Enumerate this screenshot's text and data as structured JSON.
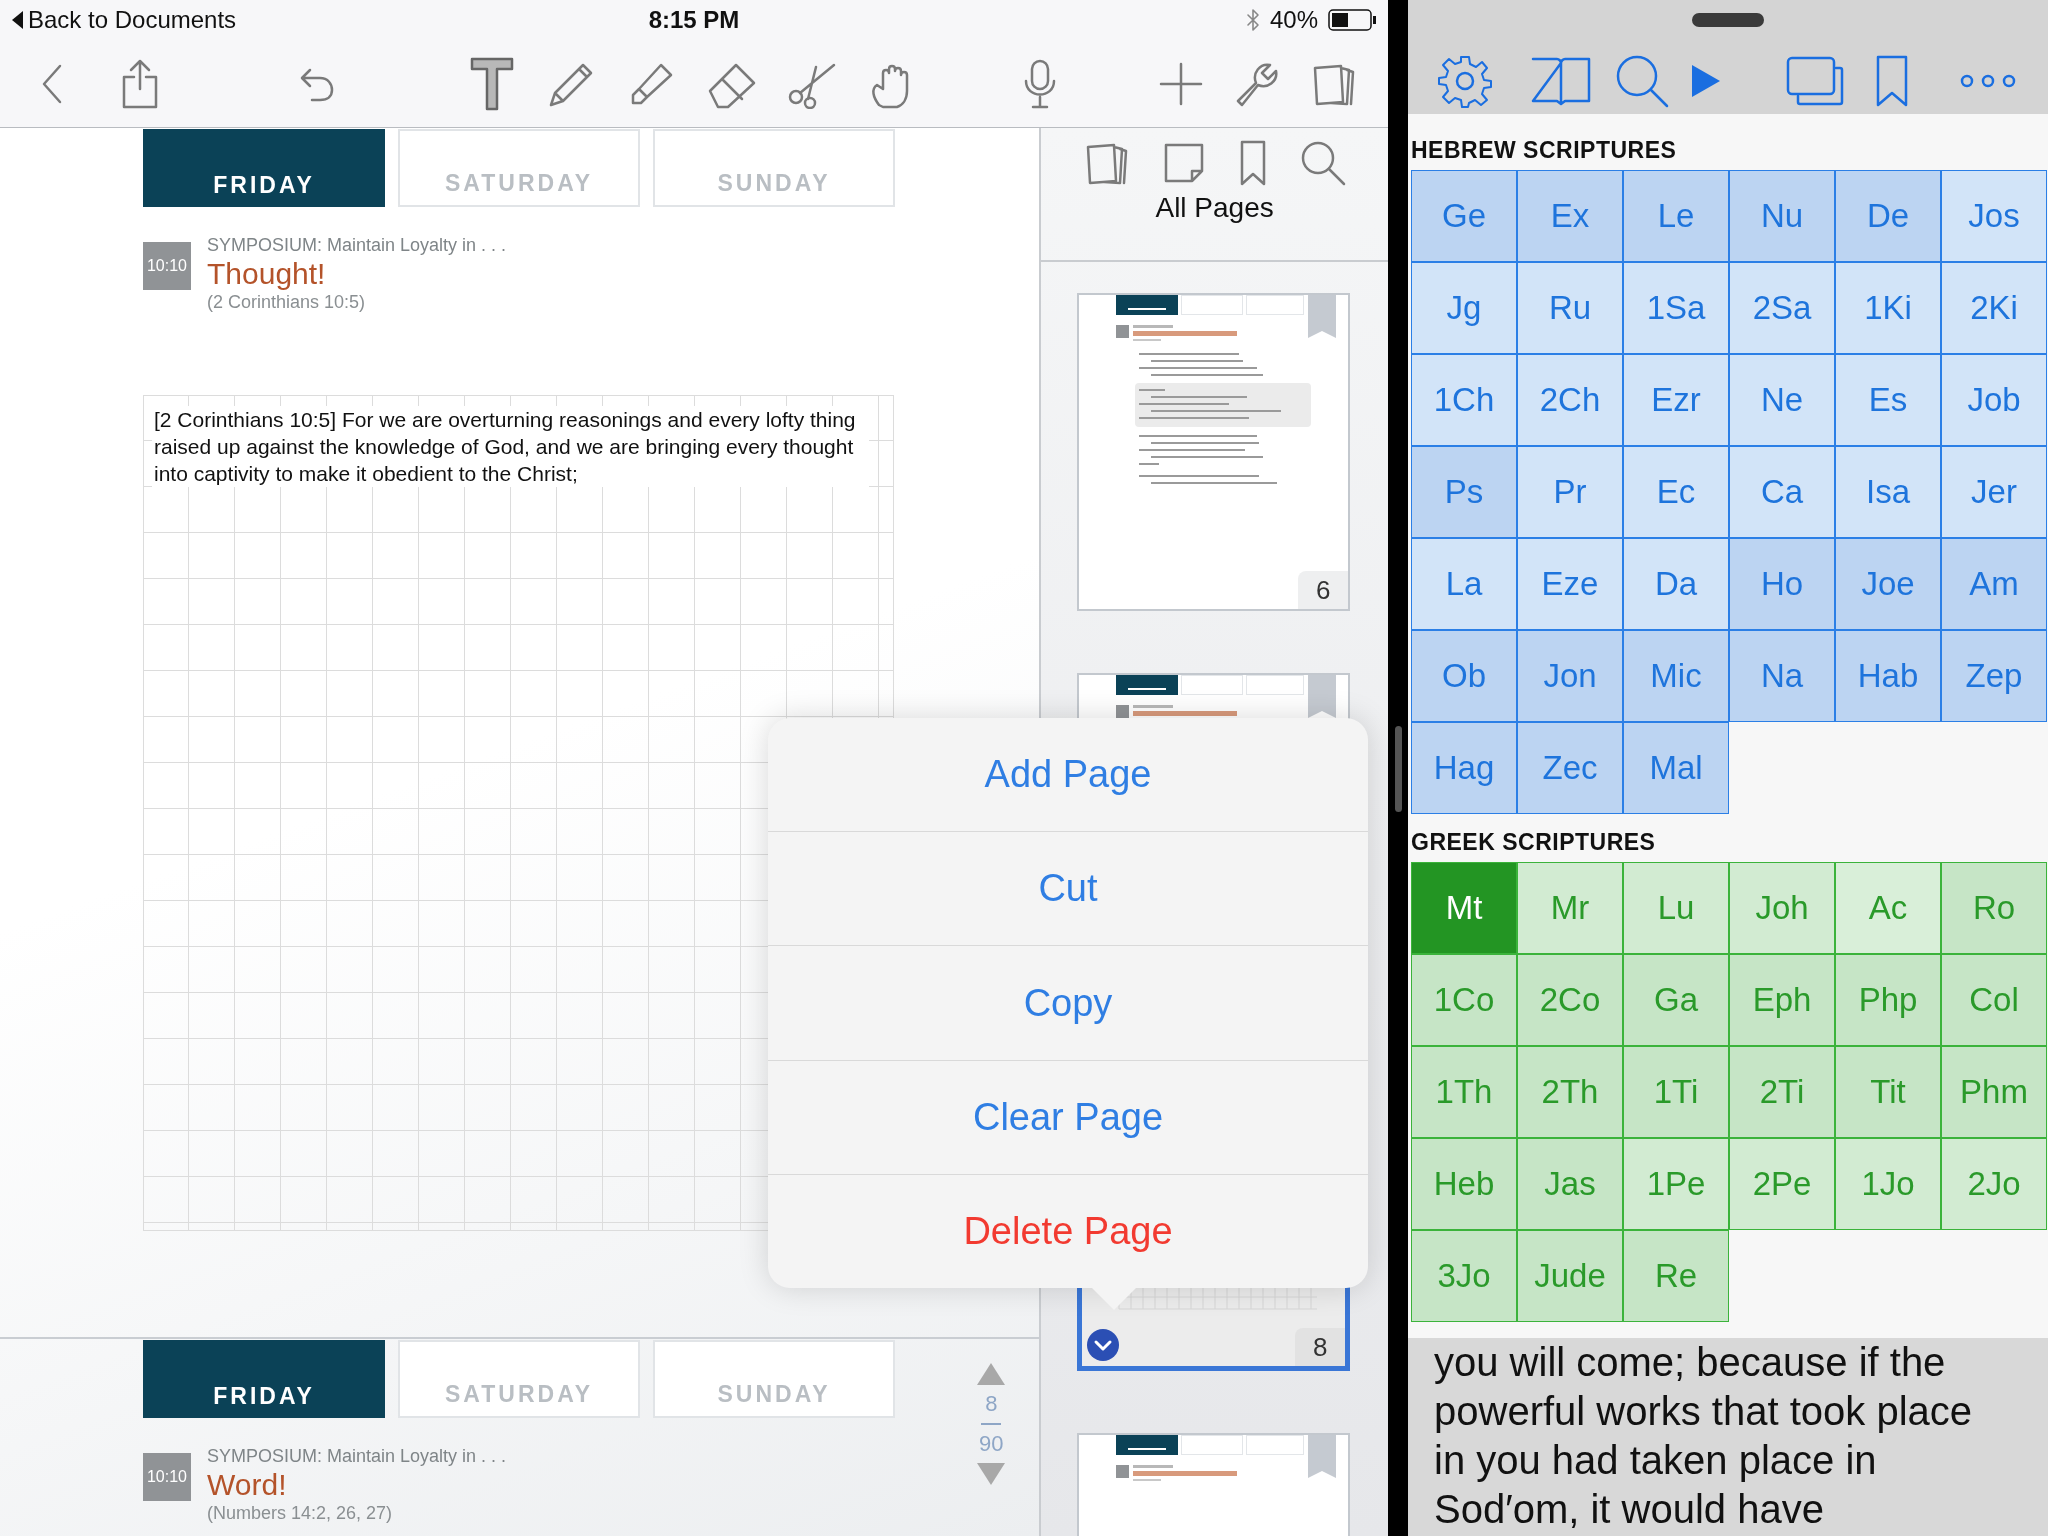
{
  "status_bar": {
    "back": "Back to Documents",
    "time": "8:15 PM",
    "battery": "40%"
  },
  "pages": [
    {
      "tabs": [
        {
          "label": "FRIDAY",
          "selected": true
        },
        {
          "label": "SATURDAY",
          "selected": false
        },
        {
          "label": "SUNDAY",
          "selected": false
        }
      ],
      "event": {
        "time": "10:10",
        "kicker": "SYMPOSIUM: Maintain Loyalty in . . .",
        "title": "Thought!",
        "reference": "(2 Corinthians 10:5)"
      },
      "note": "[2 Corinthians 10:5] For we are overturning reasonings and every lofty thing raised up against the knowledge of God, and we are bringing every thought into captivity to make it obedient to the Christ;"
    },
    {
      "tabs": [
        {
          "label": "FRIDAY",
          "selected": true
        },
        {
          "label": "SATURDAY",
          "selected": false
        },
        {
          "label": "SUNDAY",
          "selected": false
        }
      ],
      "event": {
        "time": "10:10",
        "kicker": "SYMPOSIUM: Maintain Loyalty in . . .",
        "title": "Word!",
        "reference": "(Numbers 14:2, 26, 27)"
      }
    }
  ],
  "page_indicator": {
    "current": "8",
    "total": "90"
  },
  "sidebar": {
    "title": "All Pages",
    "thumbnails": [
      {
        "kind": "song",
        "number": "6",
        "selected": false
      },
      {
        "kind": "talk",
        "selected": false
      },
      {
        "kind": "grid",
        "number": "8",
        "selected": true
      },
      {
        "kind": "talk",
        "selected": false
      }
    ]
  },
  "popover": {
    "items": [
      {
        "label": "Add Page",
        "kind": "normal"
      },
      {
        "label": "Cut",
        "kind": "normal"
      },
      {
        "label": "Copy",
        "kind": "normal"
      },
      {
        "label": "Clear Page",
        "kind": "normal"
      },
      {
        "label": "Delete Page",
        "kind": "destructive"
      }
    ]
  },
  "bible": {
    "sections": [
      {
        "title": "HEBREW SCRIPTURES",
        "kind": "hebrew",
        "books": [
          {
            "label": "Ge",
            "color": "#bcd4f2",
            "selected": false
          },
          {
            "label": "Ex",
            "color": "#bcd4f2",
            "selected": false
          },
          {
            "label": "Le",
            "color": "#bcd4f2",
            "selected": false
          },
          {
            "label": "Nu",
            "color": "#bcd4f2",
            "selected": false
          },
          {
            "label": "De",
            "color": "#bcd4f2",
            "selected": false
          },
          {
            "label": "Jos",
            "color": "#d2e4f8",
            "selected": false
          },
          {
            "label": "Jg",
            "color": "#d2e4f8",
            "selected": false
          },
          {
            "label": "Ru",
            "color": "#d2e4f8",
            "selected": false
          },
          {
            "label": "1Sa",
            "color": "#d2e4f8",
            "selected": false
          },
          {
            "label": "2Sa",
            "color": "#d2e4f8",
            "selected": false
          },
          {
            "label": "1Ki",
            "color": "#d2e4f8",
            "selected": false
          },
          {
            "label": "2Ki",
            "color": "#d2e4f8",
            "selected": false
          },
          {
            "label": "1Ch",
            "color": "#d2e4f8",
            "selected": false
          },
          {
            "label": "2Ch",
            "color": "#d2e4f8",
            "selected": false
          },
          {
            "label": "Ezr",
            "color": "#d2e4f8",
            "selected": false
          },
          {
            "label": "Ne",
            "color": "#d2e4f8",
            "selected": false
          },
          {
            "label": "Es",
            "color": "#d2e4f8",
            "selected": false
          },
          {
            "label": "Job",
            "color": "#d2e4f8",
            "selected": false
          },
          {
            "label": "Ps",
            "color": "#bcd4f2",
            "selected": false
          },
          {
            "label": "Pr",
            "color": "#d2e4f8",
            "selected": false
          },
          {
            "label": "Ec",
            "color": "#d2e4f8",
            "selected": false
          },
          {
            "label": "Ca",
            "color": "#d2e4f8",
            "selected": false
          },
          {
            "label": "Isa",
            "color": "#d2e4f8",
            "selected": false
          },
          {
            "label": "Jer",
            "color": "#d2e4f8",
            "selected": false
          },
          {
            "label": "La",
            "color": "#d2e4f8",
            "selected": false
          },
          {
            "label": "Eze",
            "color": "#d2e4f8",
            "selected": false
          },
          {
            "label": "Da",
            "color": "#d2e4f8",
            "selected": false
          },
          {
            "label": "Ho",
            "color": "#bcd4f2",
            "selected": false
          },
          {
            "label": "Joe",
            "color": "#bcd4f2",
            "selected": false
          },
          {
            "label": "Am",
            "color": "#bcd4f2",
            "selected": false
          },
          {
            "label": "Ob",
            "color": "#bcd4f2",
            "selected": false
          },
          {
            "label": "Jon",
            "color": "#bcd4f2",
            "selected": false
          },
          {
            "label": "Mic",
            "color": "#bcd4f2",
            "selected": false
          },
          {
            "label": "Na",
            "color": "#bcd4f2",
            "selected": false
          },
          {
            "label": "Hab",
            "color": "#bcd4f2",
            "selected": false
          },
          {
            "label": "Zep",
            "color": "#bcd4f2",
            "selected": false
          },
          {
            "label": "Hag",
            "color": "#bcd4f2",
            "selected": false
          },
          {
            "label": "Zec",
            "color": "#bcd4f2",
            "selected": false
          },
          {
            "label": "Mal",
            "color": "#bcd4f2",
            "selected": false
          }
        ]
      },
      {
        "title": "GREEK SCRIPTURES",
        "kind": "greek",
        "books": [
          {
            "label": "Mt",
            "selected": true
          },
          {
            "label": "Mr",
            "color": "#d2ebd2",
            "selected": false
          },
          {
            "label": "Lu",
            "color": "#d2ebd2",
            "selected": false
          },
          {
            "label": "Joh",
            "color": "#d2ebd2",
            "selected": false
          },
          {
            "label": "Ac",
            "color": "#d9efd9",
            "selected": false
          },
          {
            "label": "Ro",
            "color": "#c6e5c6",
            "selected": false
          },
          {
            "label": "1Co",
            "color": "#c6e5c6",
            "selected": false
          },
          {
            "label": "2Co",
            "color": "#c6e5c6",
            "selected": false
          },
          {
            "label": "Ga",
            "color": "#c6e5c6",
            "selected": false
          },
          {
            "label": "Eph",
            "color": "#c6e5c6",
            "selected": false
          },
          {
            "label": "Php",
            "color": "#c6e5c6",
            "selected": false
          },
          {
            "label": "Col",
            "color": "#c6e5c6",
            "selected": false
          },
          {
            "label": "1Th",
            "color": "#c6e5c6",
            "selected": false
          },
          {
            "label": "2Th",
            "color": "#c6e5c6",
            "selected": false
          },
          {
            "label": "1Ti",
            "color": "#c6e5c6",
            "selected": false
          },
          {
            "label": "2Ti",
            "color": "#c6e5c6",
            "selected": false
          },
          {
            "label": "Tit",
            "color": "#c6e5c6",
            "selected": false
          },
          {
            "label": "Phm",
            "color": "#c6e5c6",
            "selected": false
          },
          {
            "label": "Heb",
            "color": "#c6e5c6",
            "selected": false
          },
          {
            "label": "Jas",
            "color": "#c6e5c6",
            "selected": false
          },
          {
            "label": "1Pe",
            "color": "#d2ebd2",
            "selected": false
          },
          {
            "label": "2Pe",
            "color": "#d2ebd2",
            "selected": false
          },
          {
            "label": "1Jo",
            "color": "#d2ebd2",
            "selected": false
          },
          {
            "label": "2Jo",
            "color": "#d2ebd2",
            "selected": false
          },
          {
            "label": "3Jo",
            "color": "#c6e5c6",
            "selected": false
          },
          {
            "label": "Jude",
            "color": "#c6e5c6",
            "selected": false
          },
          {
            "label": "Re",
            "color": "#c6e5c6",
            "selected": false
          }
        ]
      }
    ]
  },
  "reading": {
    "text": "you will come; because if the powerful works that took place in you had taken place in Sod′om, it would have"
  }
}
